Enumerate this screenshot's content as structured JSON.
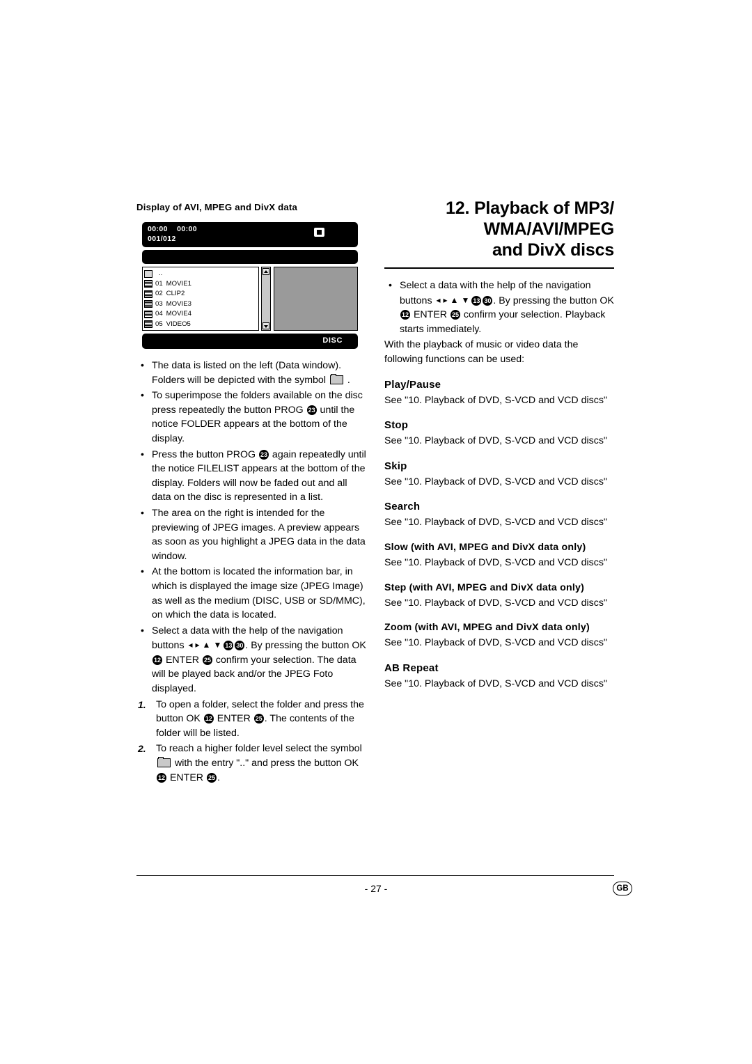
{
  "left": {
    "section_title": "Display of AVI, MPEG and DivX data",
    "device": {
      "time_elapsed": "00:00",
      "time_total": "00:00",
      "track": "001/012",
      "medium_label": "DISC",
      "list": [
        {
          "num": "",
          "name": "..",
          "icon": "folder-icon"
        },
        {
          "num": "01",
          "name": "MOVIE1",
          "icon": "file-icon"
        },
        {
          "num": "02",
          "name": "CLIP2",
          "icon": "file-icon"
        },
        {
          "num": "03",
          "name": "MOVIE3",
          "icon": "file-icon"
        },
        {
          "num": "04",
          "name": "MOVIE4",
          "icon": "file-icon"
        },
        {
          "num": "05",
          "name": "VIDEO5",
          "icon": "file-icon"
        }
      ]
    },
    "bullets": [
      "The data is listed on the left (Data window). Folders will be depicted with the symbol [FOLDER] .",
      "To superimpose the folders available on the disc press repeatedly the button PROG [23] until the notice FOLDER appears at the bottom of the display.",
      "Press the button PROG [23] again repeatedly until the notice FILELIST appears at the bottom of the display. Folders will now be faded out and all data on the disc is represented in a list.",
      "The area on the right is intended for the previewing of JPEG images. A preview appears as soon as you highlight a JPEG data in the data window.",
      "At the bottom is located the information bar, in which is displayed the image size (JPEG Image) as well as the medium (DISC, USB or SD/MMC), on which the data is located.",
      "Select a data with the help of the navigation buttons [<] [>] [^] [v] [13] [30]. By pressing the button OK [12] ENTER [25] confirm your selection. The data will be played back and/or the JPEG Foto displayed."
    ],
    "numbered": [
      {
        "num": "1.",
        "text": "To open a folder, select the folder and press the button OK [12] ENTER [25]. The contents of the folder will be listed."
      },
      {
        "num": "2.",
        "text": "To reach a higher folder level select the symbol [FOLDER] with the entry \"..\" and press the button OK [12] ENTER [25]."
      }
    ]
  },
  "right": {
    "title_line1": "12. Playback of MP3/",
    "title_line2": "WMA/AVI/MPEG",
    "title_line3": "and DivX discs",
    "bullet_1": "Select a data with the help of the navigation buttons [<] [>] [^] [v] [13] [30]. By pressing the button OK [12] ENTER [25] confirm your selection. Playback starts immediately.",
    "intro": "With the playback of music or video data the following functions can be used:",
    "sections": [
      {
        "heading": "Play/Pause",
        "ref": "See \"10. Playback of DVD, S-VCD and VCD discs\"",
        "small": false
      },
      {
        "heading": "Stop",
        "ref": "See \"10. Playback of DVD, S-VCD and VCD discs\"",
        "small": false
      },
      {
        "heading": "Skip",
        "ref": "See \"10. Playback of DVD, S-VCD and VCD discs\"",
        "small": false
      },
      {
        "heading": "Search",
        "ref": "See \"10. Playback of DVD, S-VCD and VCD discs\"",
        "small": false
      },
      {
        "heading": "Slow (with AVI, MPEG and DivX data only)",
        "ref": "See \"10. Playback of DVD, S-VCD and VCD discs\"",
        "small": true
      },
      {
        "heading": "Step (with AVI, MPEG and DivX data only)",
        "ref": "See \"10. Playback of DVD, S-VCD and VCD discs\"",
        "small": true
      },
      {
        "heading": "Zoom (with AVI, MPEG and DivX data only)",
        "ref": "See \"10. Playback of DVD, S-VCD and VCD discs\"",
        "small": true
      },
      {
        "heading": "AB Repeat",
        "ref": "See \"10. Playback of DVD, S-VCD and VCD discs\"",
        "small": false
      }
    ]
  },
  "footer": {
    "page_number": "- 27 -",
    "language_badge": "GB"
  }
}
